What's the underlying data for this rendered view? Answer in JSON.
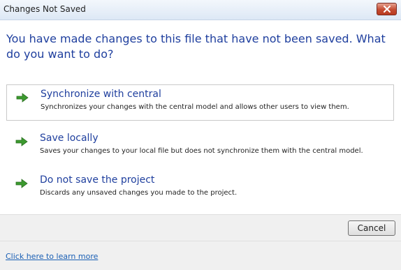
{
  "window": {
    "title": "Changes Not Saved",
    "close_icon": "close-icon"
  },
  "main": {
    "instruction": "You have made changes to this file that have not been saved.  What do you want to do?",
    "options": [
      {
        "title": "Synchronize with central",
        "description": "Synchronizes your changes with the central model and allows other users to view them.",
        "icon": "green-arrow-icon",
        "selected": true
      },
      {
        "title": "Save locally",
        "description": "Saves your changes to your local file but does not synchronize them with the central model.",
        "icon": "green-arrow-icon",
        "selected": false
      },
      {
        "title": "Do not save the project",
        "description": "Discards any unsaved changes you made to the project.",
        "icon": "green-arrow-icon",
        "selected": false
      }
    ]
  },
  "buttons": {
    "cancel_label": "Cancel"
  },
  "footer": {
    "link_text": "Click here to learn more"
  },
  "colors": {
    "instruction_text": "#1f3f9e",
    "arrow_green": "#3c9a2f",
    "link": "#1a5fb4",
    "close_button": "#c44b32"
  }
}
